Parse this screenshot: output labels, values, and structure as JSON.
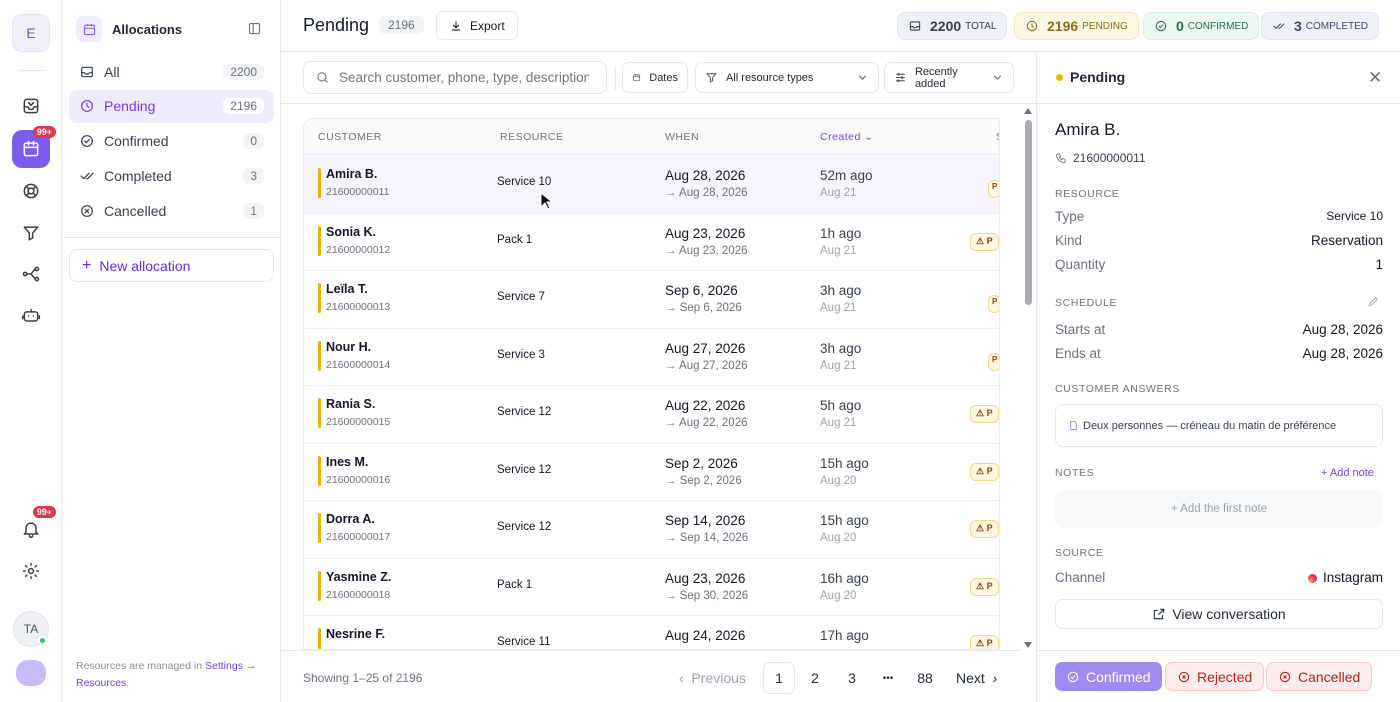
{
  "rail": {
    "workspace_initial": "E",
    "calendar_badge": "99+",
    "bell_badge": "99+",
    "avatar_initials": "TA",
    "icons": [
      "inbox-icon",
      "calendar-icon",
      "lifebuoy-icon",
      "filter-icon",
      "flow-icon",
      "robot-icon",
      "bell-icon",
      "gear-icon"
    ]
  },
  "sidebar": {
    "title": "Allocations",
    "items": [
      {
        "label": "All",
        "count": "2200",
        "icon": "inbox-icon"
      },
      {
        "label": "Pending",
        "count": "2196",
        "icon": "clock-icon"
      },
      {
        "label": "Confirmed",
        "count": "0",
        "icon": "check-circle-icon"
      },
      {
        "label": "Completed",
        "count": "3",
        "icon": "check-double-icon"
      },
      {
        "label": "Cancelled",
        "count": "1",
        "icon": "x-circle-icon"
      }
    ],
    "new_label": "New allocation",
    "footer_text": "Resources are managed in ",
    "footer_link": "Settings → Resources",
    "footer_end": "."
  },
  "header": {
    "title": "Pending",
    "count": "2196",
    "export_label": "Export",
    "stats": {
      "total_value": "2200",
      "total_label": "TOTAL",
      "pending_value": "2196",
      "pending_label": "PENDING",
      "confirmed_value": "0",
      "confirmed_label": "CONFIRMED",
      "completed_value": "3",
      "completed_label": "COMPLETED"
    }
  },
  "filters": {
    "search_placeholder": "Search customer, phone, type, description",
    "dates_label": "Dates",
    "types_label": "All resource types",
    "sort_label": "Recently added"
  },
  "table": {
    "columns": {
      "customer": "CUSTOMER",
      "resource": "RESOURCE",
      "when": "WHEN",
      "created": "Created",
      "status": "S"
    },
    "rows": [
      {
        "name": "Amira B.",
        "phone": "21600000011",
        "resource": "Service 10",
        "when_start": "Aug 28, 2026",
        "when_end": "→ Aug 28, 2026",
        "created_rel": "52m ago",
        "created_date": "Aug 21",
        "status": "P"
      },
      {
        "name": "Sonia K.",
        "phone": "21600000012",
        "resource": "Pack 1",
        "when_start": "Aug 23, 2026",
        "when_end": "→ Aug 23, 2026",
        "created_rel": "1h ago",
        "created_date": "Aug 21",
        "status": "⚠ P"
      },
      {
        "name": "Leïla T.",
        "phone": "21600000013",
        "resource": "Service 7",
        "when_start": "Sep 6, 2026",
        "when_end": "→ Sep 6, 2026",
        "created_rel": "3h ago",
        "created_date": "Aug 21",
        "status": "P"
      },
      {
        "name": "Nour H.",
        "phone": "21600000014",
        "resource": "Service 3",
        "when_start": "Aug 27, 2026",
        "when_end": "→ Aug 27, 2026",
        "created_rel": "3h ago",
        "created_date": "Aug 21",
        "status": "P"
      },
      {
        "name": "Rania S.",
        "phone": "21600000015",
        "resource": "Service 12",
        "when_start": "Aug 22, 2026",
        "when_end": "→ Aug 22, 2026",
        "created_rel": "5h ago",
        "created_date": "Aug 21",
        "status": "⚠ P"
      },
      {
        "name": "Ines M.",
        "phone": "21600000016",
        "resource": "Service 12",
        "when_start": "Sep 2, 2026",
        "when_end": "→ Sep 2, 2026",
        "created_rel": "15h ago",
        "created_date": "Aug 20",
        "status": "⚠ P"
      },
      {
        "name": "Dorra A.",
        "phone": "21600000017",
        "resource": "Service 12",
        "when_start": "Sep 14, 2026",
        "when_end": "→ Sep 14, 2026",
        "created_rel": "15h ago",
        "created_date": "Aug 20",
        "status": "⚠ P"
      },
      {
        "name": "Yasmine Z.",
        "phone": "21600000018",
        "resource": "Pack 1",
        "when_start": "Aug 23, 2026",
        "when_end": "→ Sep 30, 2026",
        "created_rel": "16h ago",
        "created_date": "Aug 20",
        "status": "⚠ P"
      },
      {
        "name": "Nesrine F.",
        "phone": "",
        "resource": "Service 11",
        "when_start": "Aug 24, 2026",
        "when_end": "",
        "created_rel": "17h ago",
        "created_date": "",
        "status": "⚠ P"
      }
    ]
  },
  "pagination": {
    "showing": "Showing 1–25 of 2196",
    "prev": "Previous",
    "pages": [
      "1",
      "2",
      "3",
      "•••",
      "88"
    ],
    "next": "Next"
  },
  "detail": {
    "status_title": "Pending",
    "name": "Amira B.",
    "phone": "21600000011",
    "resource_heading": "RESOURCE",
    "type_label": "Type",
    "type_value": "Service 10",
    "kind_label": "Kind",
    "kind_value": "Reservation",
    "qty_label": "Quantity",
    "qty_value": "1",
    "schedule_heading": "SCHEDULE",
    "starts_label": "Starts at",
    "starts_value": "Aug 28, 2026",
    "ends_label": "Ends at",
    "ends_value": "Aug 28, 2026",
    "answers_heading": "CUSTOMER ANSWERS",
    "answer_text": "Deux personnes — créneau du matin de préférence",
    "notes_heading": "NOTES",
    "add_note": "+ Add note",
    "first_note": "+ Add the first note",
    "source_heading": "SOURCE",
    "channel_label": "Channel",
    "channel_value": "Instagram",
    "view_conv": "View conversation",
    "btn_confirm": "Confirmed",
    "btn_reject": "Rejected",
    "btn_cancel": "Cancelled"
  }
}
